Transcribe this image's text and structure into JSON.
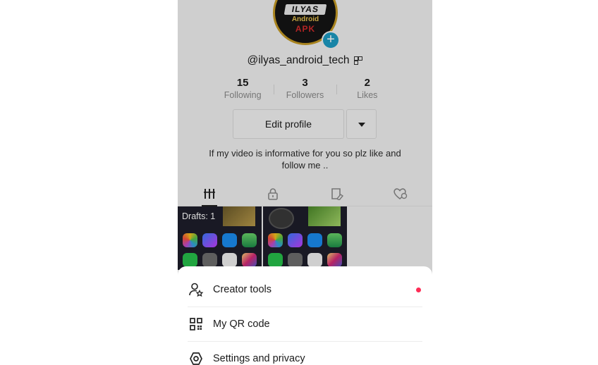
{
  "profile": {
    "avatar_text": {
      "line1": "ILYAS",
      "line2": "Android",
      "line3": "APK"
    },
    "username": "@ilyas_android_tech",
    "stats": [
      {
        "value": "15",
        "label": "Following"
      },
      {
        "value": "3",
        "label": "Followers"
      },
      {
        "value": "2",
        "label": "Likes"
      }
    ],
    "edit_profile_label": "Edit profile",
    "bio": "If my video is informative for you so plz like and follow me .."
  },
  "tabs": [
    {
      "icon": "videos-grid-icon",
      "active": true
    },
    {
      "icon": "lock-icon",
      "active": false
    },
    {
      "icon": "bookmark-icon",
      "active": false
    },
    {
      "icon": "liked-heart-icon",
      "active": false
    }
  ],
  "grid": {
    "drafts_label": "Drafts: 1"
  },
  "sheet": {
    "items": [
      {
        "label": "Creator tools",
        "icon": "creator-tools-icon",
        "has_dot": true
      },
      {
        "label": "My QR code",
        "icon": "qr-code-icon",
        "has_dot": false
      },
      {
        "label": "Settings and privacy",
        "icon": "settings-gear-icon",
        "has_dot": false
      }
    ]
  },
  "colors": {
    "accent_blue": "#1d9bc3",
    "notification_dot": "#fe2c55",
    "avatar_ring": "#c59a25"
  }
}
